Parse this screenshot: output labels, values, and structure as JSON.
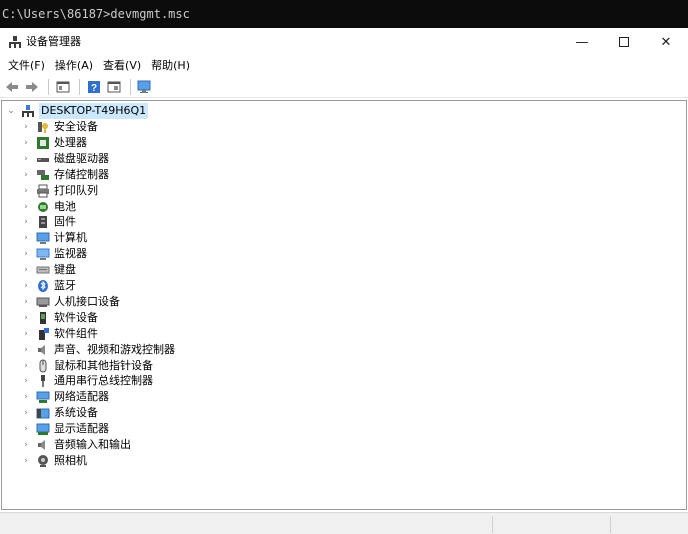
{
  "console": {
    "command_line": "C:\\Users\\86187>devmgmt.msc"
  },
  "window": {
    "title": "设备管理器",
    "controls": {
      "minimize": "—",
      "close": "✕"
    }
  },
  "menu": [
    "文件(F)",
    "操作(A)",
    "查看(V)",
    "帮助(H)"
  ],
  "toolbar": [
    "back-icon",
    "forward-icon",
    "properties-icon",
    "help-icon",
    "view-icon",
    "monitor-icon"
  ],
  "tree": {
    "root": {
      "label": "DESKTOP-T49H6Q1",
      "expanded": true,
      "icon": "computer-icon"
    },
    "items": [
      {
        "label": "安全设备",
        "icon": "security-key-icon"
      },
      {
        "label": "处理器",
        "icon": "cpu-icon"
      },
      {
        "label": "磁盘驱动器",
        "icon": "disk-drive-icon"
      },
      {
        "label": "存储控制器",
        "icon": "storage-controller-icon"
      },
      {
        "label": "打印队列",
        "icon": "printer-icon"
      },
      {
        "label": "电池",
        "icon": "battery-icon"
      },
      {
        "label": "固件",
        "icon": "firmware-icon"
      },
      {
        "label": "计算机",
        "icon": "computer-monitor-icon"
      },
      {
        "label": "监视器",
        "icon": "display-monitor-icon"
      },
      {
        "label": "键盘",
        "icon": "keyboard-icon"
      },
      {
        "label": "蓝牙",
        "icon": "bluetooth-icon"
      },
      {
        "label": "人机接口设备",
        "icon": "hid-icon"
      },
      {
        "label": "软件设备",
        "icon": "software-device-icon"
      },
      {
        "label": "软件组件",
        "icon": "software-component-icon"
      },
      {
        "label": "声音、视频和游戏控制器",
        "icon": "speaker-icon"
      },
      {
        "label": "鼠标和其他指针设备",
        "icon": "mouse-icon"
      },
      {
        "label": "通用串行总线控制器",
        "icon": "usb-icon"
      },
      {
        "label": "网络适配器",
        "icon": "network-adapter-icon"
      },
      {
        "label": "系统设备",
        "icon": "system-device-icon"
      },
      {
        "label": "显示适配器",
        "icon": "display-adapter-icon"
      },
      {
        "label": "音频输入和输出",
        "icon": "audio-io-icon"
      },
      {
        "label": "照相机",
        "icon": "camera-icon"
      }
    ]
  },
  "colors": {
    "selection": "#cce8ff",
    "console_bg": "#0c0c0c",
    "console_fg": "#cccccc",
    "icon_blue": "#3a7bd5"
  }
}
